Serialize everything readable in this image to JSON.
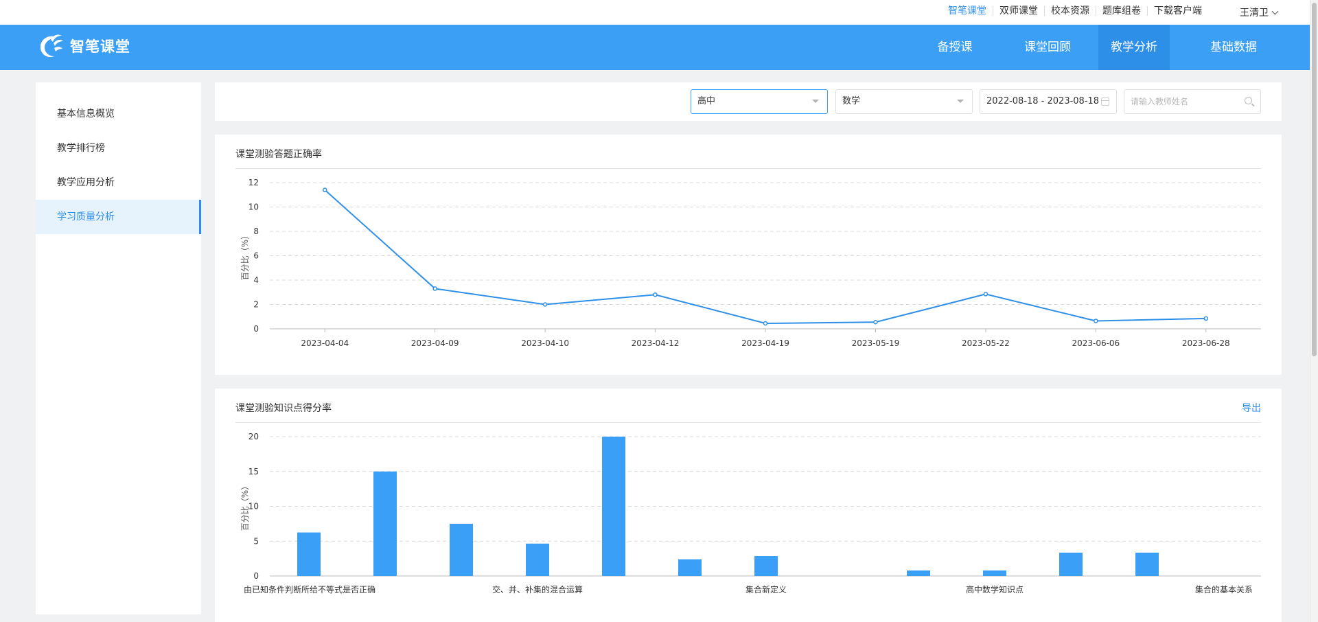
{
  "topbar": {
    "links": [
      "智笔课堂",
      "双师课堂",
      "校本资源",
      "题库组卷",
      "下载客户端"
    ],
    "active_index": 0,
    "user_name": "王清卫"
  },
  "header": {
    "brand": "智笔课堂",
    "nav": [
      "备授课",
      "课堂回顾",
      "教学分析",
      "基础数据"
    ],
    "active_index": 2
  },
  "sidebar": {
    "items": [
      "基本信息概览",
      "教学排行榜",
      "教学应用分析",
      "学习质量分析"
    ],
    "active_index": 3
  },
  "filters": {
    "stage": "高中",
    "subject": "数学",
    "date_range": "2022-08-18 - 2023-08-18",
    "teacher_placeholder": "请输入教师姓名"
  },
  "card1": {
    "title": "课堂测验答题正确率"
  },
  "card2": {
    "title": "课堂测验知识点得分率",
    "export_label": "导出"
  },
  "colors": {
    "accent": "#2e8fe8",
    "header": "#3a9ff5",
    "bar": "#3aa0f7",
    "line": "#2e8fe8"
  },
  "chart_data": [
    {
      "type": "line",
      "title": "课堂测验答题正确率",
      "ylabel": "百分比（%）",
      "ylim": [
        0,
        12
      ],
      "yticks": [
        0,
        2,
        4,
        6,
        8,
        10,
        12
      ],
      "categories": [
        "2023-04-04",
        "2023-04-09",
        "2023-04-10",
        "2023-04-12",
        "2023-04-19",
        "2023-05-19",
        "2023-05-22",
        "2023-06-06",
        "2023-06-28"
      ],
      "values": [
        11.4,
        3.3,
        2.0,
        2.8,
        0.45,
        0.55,
        2.85,
        0.65,
        0.85
      ],
      "grid": true
    },
    {
      "type": "bar",
      "title": "课堂测验知识点得分率",
      "ylabel": "百分比（%）",
      "ylim": [
        0,
        20
      ],
      "yticks": [
        0,
        5,
        10,
        15,
        20
      ],
      "values": [
        6.25,
        15,
        7.5,
        4.65,
        20,
        2.4,
        2.85,
        0,
        0.8,
        0.8,
        3.35,
        3.35,
        0
      ],
      "category_labels_shown": [
        {
          "index": 0,
          "label": "由已知条件判断所给不等式是否正确"
        },
        {
          "index": 3,
          "label": "交、并、补集的混合运算"
        },
        {
          "index": 6,
          "label": "集合新定义"
        },
        {
          "index": 9,
          "label": "高中数学知识点"
        },
        {
          "index": 12,
          "label": "集合的基本关系"
        }
      ],
      "grid": true
    }
  ]
}
